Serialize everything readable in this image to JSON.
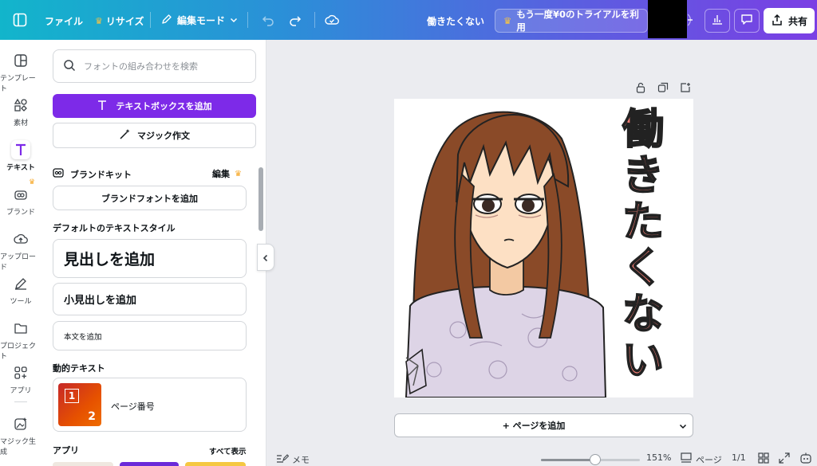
{
  "topbar": {
    "file": "ファイル",
    "resize": "リサイズ",
    "edit_mode": "編集モード",
    "doc_title": "働きたくない",
    "trial": "もう一度¥0のトライアルを利用",
    "share": "共有"
  },
  "rail": {
    "items": [
      {
        "label": "テンプレート",
        "icon": "template-icon"
      },
      {
        "label": "素材",
        "icon": "elements-icon"
      },
      {
        "label": "テキスト",
        "icon": "text-icon"
      },
      {
        "label": "ブランド",
        "icon": "brand-icon"
      },
      {
        "label": "アップロード",
        "icon": "upload-icon"
      },
      {
        "label": "ツール",
        "icon": "tools-icon"
      },
      {
        "label": "プロジェクト",
        "icon": "projects-icon"
      },
      {
        "label": "アプリ",
        "icon": "apps-icon"
      },
      {
        "label": "マジック生成",
        "icon": "magic-media-icon"
      }
    ]
  },
  "panel": {
    "search_placeholder": "フォントの組み合わせを検索",
    "add_textbox": "テキストボックスを追加",
    "magic_write": "マジック作文",
    "brand_kit": "ブランドキット",
    "edit": "編集",
    "add_brand_font": "ブランドフォントを追加",
    "default_styles": "デフォルトのテキストスタイル",
    "add_heading": "見出しを追加",
    "add_subheading": "小見出しを追加",
    "add_body": "本文を追加",
    "dynamic_text": "動的テキスト",
    "page_number": "ページ番号",
    "thumb_num_1": "1",
    "thumb_num_2": "2",
    "apps": "アプリ",
    "see_all": "すべて表示"
  },
  "canvas": {
    "artwork_text": [
      "働",
      "き",
      "た",
      "く",
      "な",
      "い"
    ],
    "add_page": "+ ページを追加"
  },
  "bottombar": {
    "notes": "メモ",
    "zoom": "151%",
    "zoom_fraction": 0.55,
    "pages": "ページ",
    "page_count": "1/1"
  },
  "colors": {
    "accent": "#7d2ae8",
    "artwork_text": "#f47e75"
  }
}
